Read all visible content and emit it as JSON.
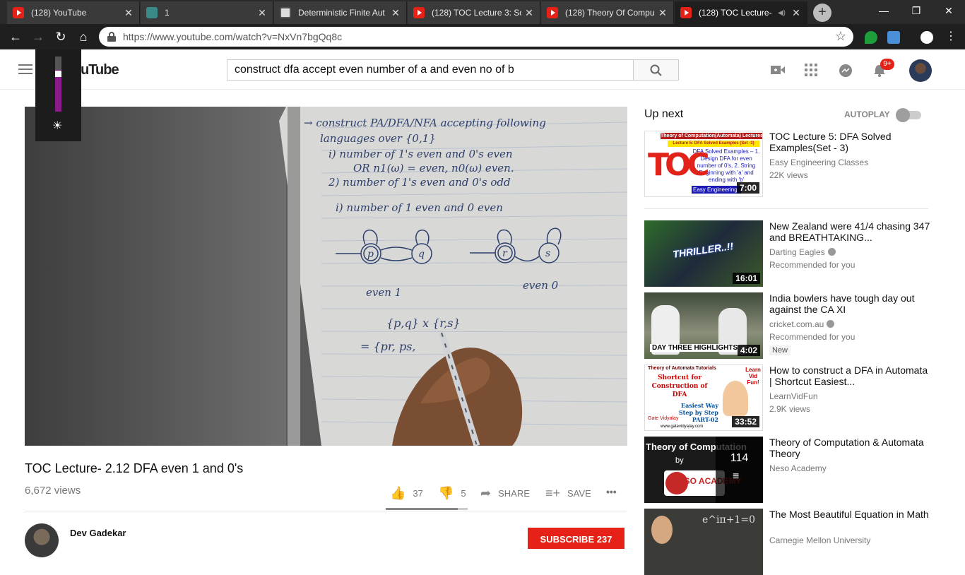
{
  "browser": {
    "tabs": [
      {
        "title": "(128) YouTube",
        "icon": "youtube-icon",
        "active": false
      },
      {
        "title": "1",
        "icon": "globe-icon",
        "active": false
      },
      {
        "title": "Deterministic Finite Aut",
        "icon": "dfa-site-icon",
        "active": false
      },
      {
        "title": "(128) TOC Lecture 3: So",
        "icon": "youtube-icon",
        "active": false
      },
      {
        "title": "(128) Theory Of Compu",
        "icon": "youtube-icon",
        "active": false
      },
      {
        "title": "(128) TOC Lecture-",
        "icon": "youtube-icon",
        "active": true
      }
    ],
    "url": "https://www.youtube.com/watch?v=NxVn7bgQq8c"
  },
  "youtube": {
    "logo": "YouTube",
    "search_query": "construct dfa accept even number of a and even no of b",
    "notification_count": "9+"
  },
  "brightness": {
    "level": 0.75
  },
  "video": {
    "title": "TOC Lecture- 2.12 DFA even 1 and 0's",
    "views": "6,672 views",
    "likes": "37",
    "dislikes": "5",
    "share_label": "SHARE",
    "save_label": "SAVE",
    "more_label": "•••",
    "like_ratio": 0.88,
    "handwriting": {
      "line1": "→ construct PA/DFA/NFA accepting following",
      "line2": "languages over {0,1}",
      "line3": "i) number of 1's even and 0's even",
      "line4": "OR   n1(ω) = even, n0(ω) even.",
      "line5": "2) number of 1's even and 0's odd",
      "line6": "i) number of 1 even and 0 even",
      "state_p": "p",
      "state_q": "q",
      "state_r": "r",
      "state_s": "s",
      "product": "{p,q} x {r,s}",
      "product2": "= {pr, ps,",
      "even1": "even 1",
      "even0": "even 0"
    }
  },
  "channel": {
    "name": "Dev Gadekar",
    "subscribe_label": "SUBSCRIBE",
    "subscriber_count": "237"
  },
  "sidebar": {
    "up_next": "Up next",
    "autoplay": "AUTOPLAY",
    "autoplay_on": false,
    "items": [
      {
        "title": "TOC Lecture 5: DFA Solved Examples(Set - 3)",
        "channel": "Easy Engineering Classes",
        "meta": "22K views",
        "duration": "7:00",
        "verified": false,
        "badge": "",
        "thumb_top": "Theory of Computation(Automata) Lectures",
        "thumb_sub": "Lecture 5: DFA Solved Examples (Set -3)",
        "thumb_body": "DFA Solved Examples – 1. Design DFA for even number of 0's, 2. String Beginning with 'a' and ending with 'b'",
        "thumb_logo": "TOC",
        "thumb_footer": "Easy Engineering"
      },
      {
        "title": "New Zealand were 41/4 chasing 347 and BREATHTAKING...",
        "channel": "Darting Eagles",
        "meta": "Recommended for you",
        "duration": "16:01",
        "verified": true,
        "badge": "",
        "thumb_text": "THRILLER..!!"
      },
      {
        "title": "India bowlers have tough day out against the CA XI",
        "channel": "cricket.com.au",
        "meta": "Recommended for you",
        "duration": "4:02",
        "verified": true,
        "badge": "New",
        "thumb_text": "DAY THREE HIGHLIGHTS"
      },
      {
        "title": "How to construct a DFA in Automata | Shortcut Easiest...",
        "channel": "LearnVidFun",
        "meta": "2.9K views",
        "duration": "33:52",
        "verified": false,
        "badge": "",
        "thumb_top": "Theory of Automata Tutorials",
        "thumb_title": "Shortcut for Construction of DFA",
        "thumb_tag": "Learn Vid Fun!",
        "thumb_way": "Easiest Way Step by Step PART-02",
        "thumb_brand": "Gate Vidyalay",
        "thumb_url": "www.gatevidyalay.com"
      },
      {
        "title": "Theory of Computation & Automata Theory",
        "channel": "Neso Academy",
        "meta": "",
        "duration": "",
        "verified": false,
        "badge": "",
        "playlist_count": "114",
        "thumb_top": "Theory of Computation",
        "thumb_by": "by",
        "thumb_brand": "NESO ACADEMY"
      },
      {
        "title": "The Most Beautiful Equation in Math",
        "channel": "Carnegie Mellon University",
        "meta": "",
        "duration": "",
        "verified": false,
        "badge": "",
        "thumb_eq": "e^iπ+1=0"
      }
    ]
  },
  "colors": {
    "youtube_red": "#e62117",
    "chrome_dark": "#1f1f1f",
    "brightness_purple": "#8b1b8b"
  }
}
